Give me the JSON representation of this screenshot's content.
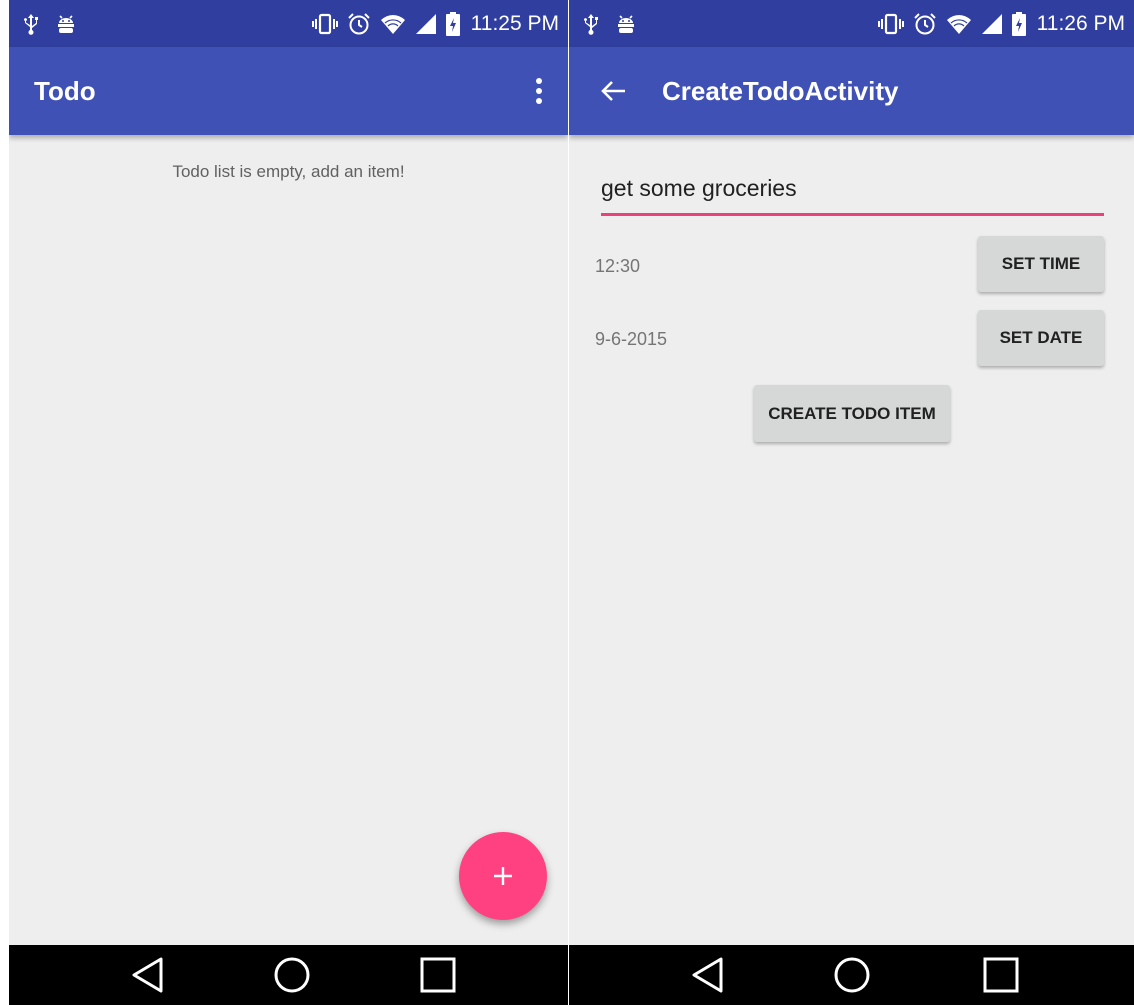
{
  "left_screen": {
    "status_bar": {
      "time": "11:25 PM",
      "left_icons": [
        "usb-icon",
        "android-debug-icon"
      ],
      "right_icons": [
        "vibrate-icon",
        "alarm-icon",
        "wifi-icon",
        "cell-signal-icon",
        "battery-charging-icon"
      ]
    },
    "app_bar": {
      "title": "Todo",
      "overflow_icon": "more-vert-icon"
    },
    "empty_message": "Todo list is empty, add an item!",
    "fab": {
      "icon": "plus-icon",
      "color": "#ff4081"
    }
  },
  "right_screen": {
    "status_bar": {
      "time": "11:26 PM",
      "left_icons": [
        "usb-icon",
        "android-debug-icon"
      ],
      "right_icons": [
        "vibrate-icon",
        "alarm-icon",
        "wifi-icon",
        "cell-signal-icon",
        "battery-charging-icon"
      ]
    },
    "app_bar": {
      "title": "CreateTodoActivity",
      "back_icon": "arrow-back-icon"
    },
    "form": {
      "todo_text": "get some groceries",
      "time_value": "12:30",
      "set_time_label": "SET TIME",
      "date_value": "9-6-2015",
      "set_date_label": "SET DATE",
      "create_label": "CREATE TODO ITEM"
    }
  },
  "nav_bar": {
    "buttons": [
      "back-triangle-icon",
      "home-circle-icon",
      "recents-square-icon"
    ]
  },
  "colors": {
    "primary": "#3f51b5",
    "primary_dark": "#303f9f",
    "accent": "#ff4081",
    "background": "#eeeeee",
    "button": "#d6d7d7"
  }
}
